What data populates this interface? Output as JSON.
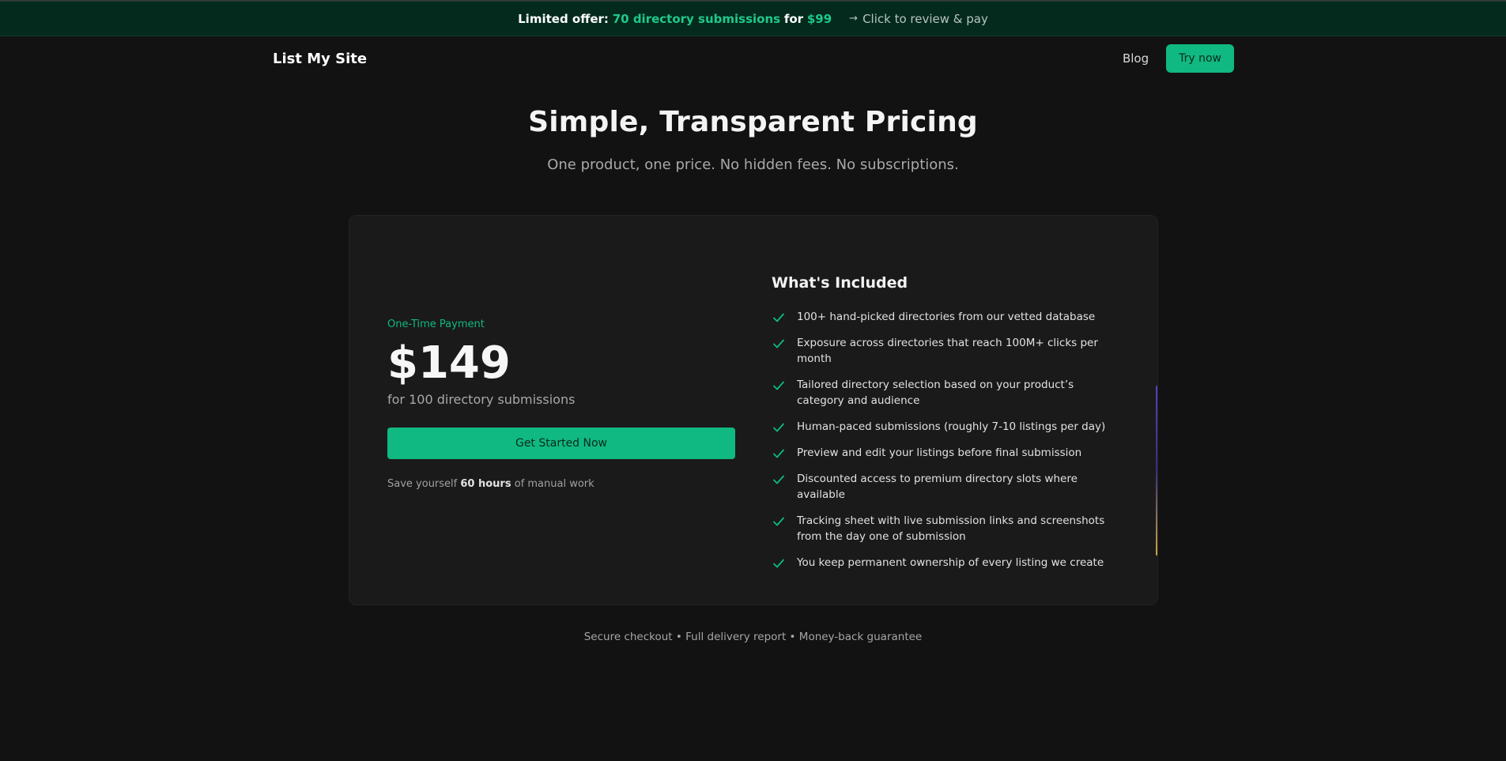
{
  "banner": {
    "prefix": "Limited offer:",
    "highlight": "70 directory submissions",
    "for_text": "for",
    "price": "$99",
    "arrow": "→",
    "cta": "Click to review & pay"
  },
  "nav": {
    "logo": "List My Site",
    "blog": "Blog",
    "try_now": "Try now"
  },
  "hero": {
    "title": "Simple, Transparent Pricing",
    "subtitle": "One product, one price. No hidden fees. No subscriptions."
  },
  "pricing": {
    "label": "One-Time Payment",
    "price": "$149",
    "price_sub": "for 100 directory submissions",
    "cta": "Get Started Now",
    "save_prefix": "Save yourself",
    "save_hours": "60 hours",
    "save_suffix": "of manual work"
  },
  "included": {
    "title": "What's Included",
    "items": [
      "100+ hand-picked directories from our vetted database",
      "Exposure across directories that reach 100M+ clicks per month",
      "Tailored directory selection based on your product’s category and audience",
      "Human-paced submissions (roughly 7-10 listings per day)",
      "Preview and edit your listings before final submission",
      "Discounted access to premium directory slots where available",
      "Tracking sheet with live submission links and screenshots from the day one of submission",
      "You keep permanent ownership of every listing we create"
    ]
  },
  "footer": {
    "note": "Secure checkout • Full delivery report • Money-back guarantee"
  },
  "icons": {
    "feature": "check-icon"
  },
  "colors": {
    "accent": "#10b981",
    "background": "#121212",
    "card": "#1a1a1a",
    "banner": "#032a1d"
  }
}
